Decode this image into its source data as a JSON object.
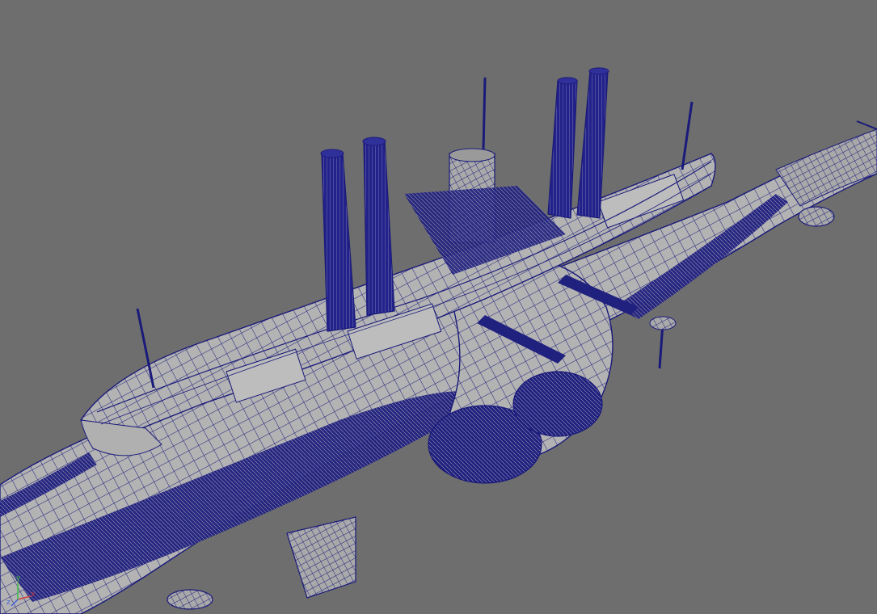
{
  "viewport": {
    "background_color": "#6e6e6e",
    "wire_color": "#1a1a7a",
    "mesh_color": "#b4b4b4",
    "dark_mesh_color": "#8e8e8e",
    "shading": "wireframe-on-shaded",
    "model_subject": "airship-battleship-model"
  },
  "axis_gizmo": {
    "x_label": "x",
    "y_label": "y",
    "z_label": "z",
    "x_color": "#d04040",
    "y_color": "#40c040",
    "z_color": "#4060e0"
  }
}
